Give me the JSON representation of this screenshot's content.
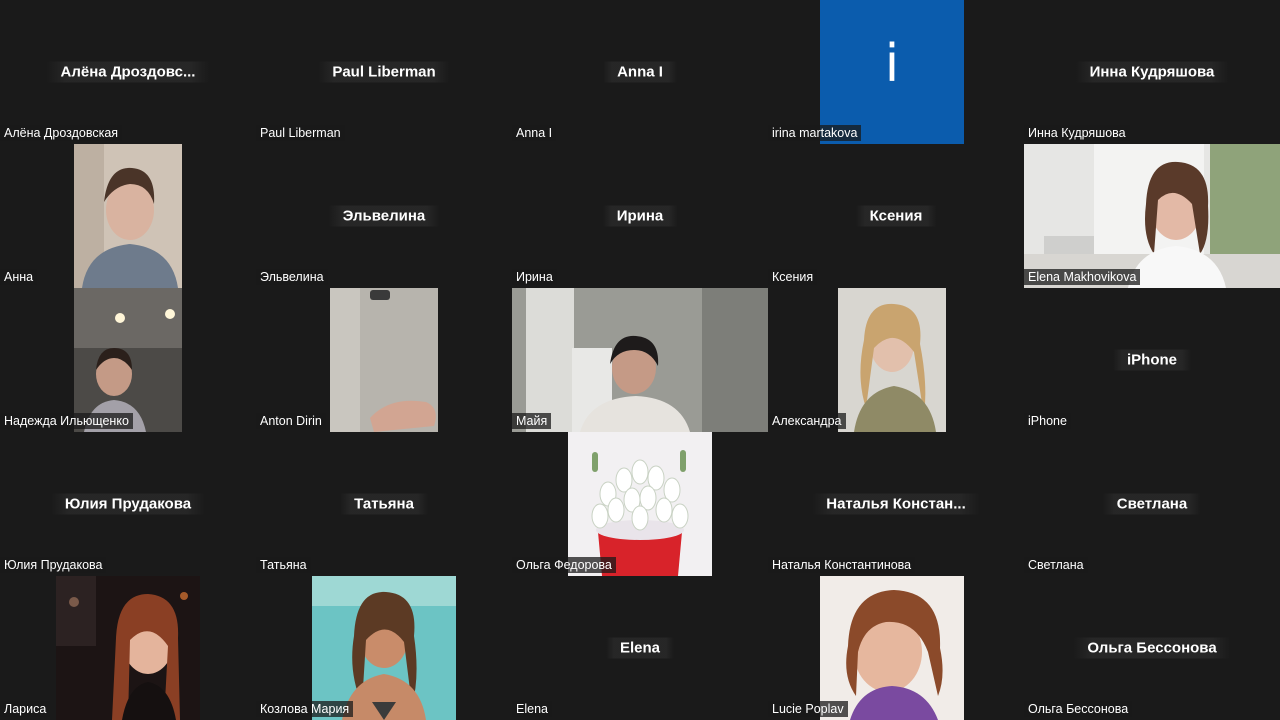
{
  "tiles": [
    {
      "label": "Алёна Дроздовская",
      "center": "Алёна  Дроздовс..."
    },
    {
      "label": "Paul Liberman",
      "center": "Paul Liberman"
    },
    {
      "label": "Anna I",
      "center": "Anna I"
    },
    {
      "label": "irina martakova",
      "center": "i"
    },
    {
      "label": "Инна Кудряшова",
      "center": "Инна Кудряшова"
    },
    {
      "label": "Анна",
      "center": ""
    },
    {
      "label": "Эльвелина",
      "center": "Эльвелина"
    },
    {
      "label": "Ирина",
      "center": "Ирина"
    },
    {
      "label": "Ксения",
      "center": "Ксения"
    },
    {
      "label": "Elena Makhovikova",
      "center": ""
    },
    {
      "label": "Надежда Ильющенко",
      "center": ""
    },
    {
      "label": "Anton Dirin",
      "center": ""
    },
    {
      "label": "Майя",
      "center": ""
    },
    {
      "label": "Александра",
      "center": ""
    },
    {
      "label": "iPhone",
      "center": "iPhone"
    },
    {
      "label": "Юлия Прудакова",
      "center": "Юлия Прудакова"
    },
    {
      "label": "Татьяна",
      "center": "Татьяна"
    },
    {
      "label": "Ольга Федорова",
      "center": ""
    },
    {
      "label": "Наталья Константинова",
      "center": "Наталья  Констан..."
    },
    {
      "label": "Светлана",
      "center": "Светлана"
    },
    {
      "label": "Лариса",
      "center": ""
    },
    {
      "label": "Козлова Мария",
      "center": ""
    },
    {
      "label": "Elena",
      "center": "Elena"
    },
    {
      "label": "Lucie Poplav",
      "center": ""
    },
    {
      "label": "Ольга Бессонова",
      "center": "Ольга Бессонова"
    }
  ],
  "colors": {
    "background": "#1a1a1a",
    "avatar_blue": "#0b5cad"
  }
}
